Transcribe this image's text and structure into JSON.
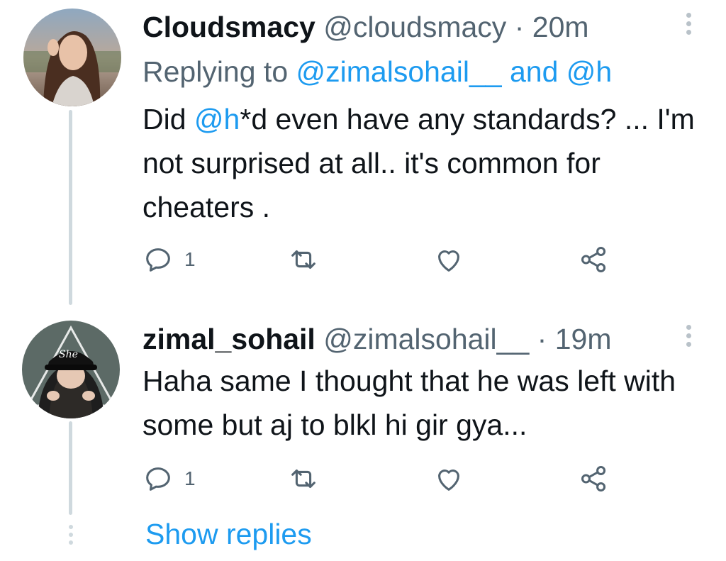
{
  "tweets": [
    {
      "name": "Cloudsmacy",
      "handle": "@cloudsmacy",
      "sep": "·",
      "time": "20m",
      "replying_prefix": "Replying to",
      "replying_user1": "@zimalsohail__",
      "replying_and": "and",
      "replying_user2": "@h",
      "text_pre": "Did ",
      "text_mention": "@h",
      "text_post": "*d even have any standards? ... I'm not surprised at all.. it's common for cheaters .",
      "reply_count": "1",
      "icons": {
        "reply": "reply-icon",
        "retweet": "retweet-icon",
        "like": "heart-icon",
        "share": "share-icon",
        "more": "more-icon"
      }
    },
    {
      "name": "zimal_sohail",
      "handle": "@zimalsohail__",
      "sep": "·",
      "time": "19m",
      "text": "Haha same I thought that he was left with some but aj to blkl hi gir gya...",
      "reply_count": "1",
      "icons": {
        "reply": "reply-icon",
        "retweet": "retweet-icon",
        "like": "heart-icon",
        "share": "share-icon",
        "more": "more-icon"
      }
    }
  ],
  "show_replies": "Show replies",
  "colors": {
    "link": "#1d9bf0",
    "secondary": "#536471",
    "text": "#0f1419",
    "line": "#cfd9de"
  }
}
